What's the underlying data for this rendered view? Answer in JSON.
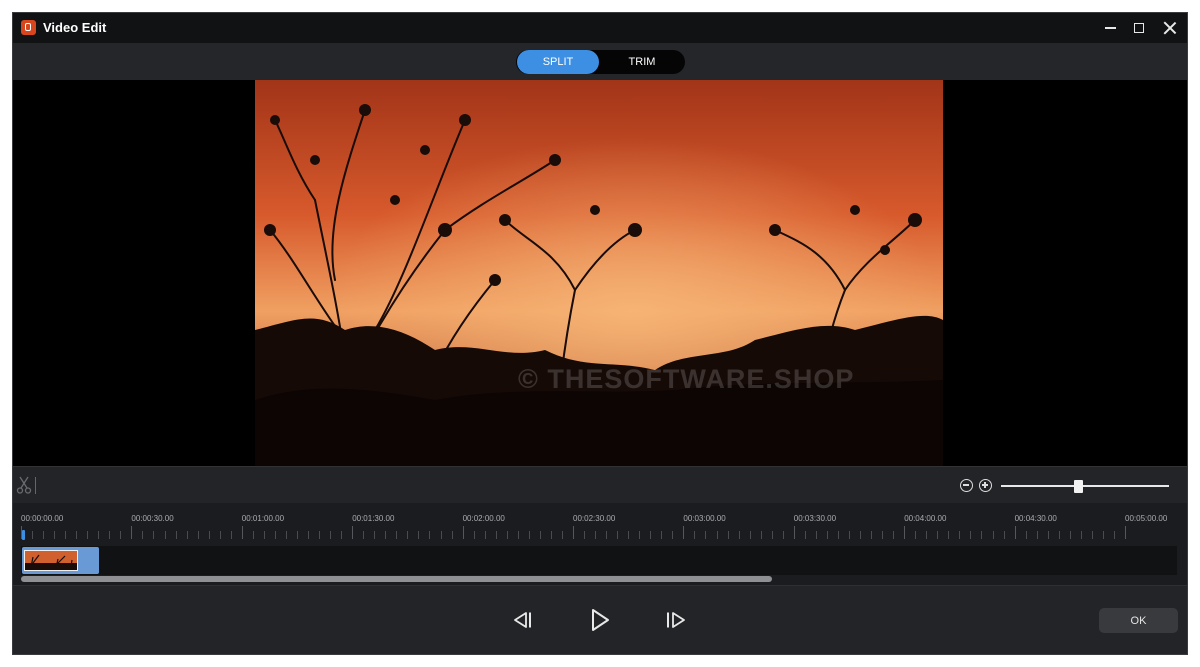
{
  "window": {
    "title": "Video Edit"
  },
  "mode_tabs": [
    {
      "label": "SPLIT",
      "active": true
    },
    {
      "label": "TRIM",
      "active": false
    }
  ],
  "preview": {
    "watermark": "© THESOFTWARE.SHOP"
  },
  "zoom": {
    "level": 0.46
  },
  "timeline": {
    "time_labels": [
      "00:00:00.00",
      "00:00:30.00",
      "00:01:00.00",
      "00:01:30.00",
      "00:02:00.00",
      "00:02:30.00",
      "00:03:00.00",
      "00:03:30.00",
      "00:04:00.00",
      "00:04:30.00",
      "00:05:00.00"
    ],
    "scroll_fraction": 0.65
  },
  "controls": {
    "ok_label": "OK"
  },
  "colors": {
    "accent": "#3d8fe3",
    "clip": "#6a9ad6",
    "background": "#1e1f22"
  },
  "icons": [
    "app-icon",
    "minimize-icon",
    "maximize-icon",
    "close-icon",
    "scissors-icon",
    "zoom-out-icon",
    "zoom-in-icon",
    "previous-frame-icon",
    "play-icon",
    "next-frame-icon"
  ]
}
